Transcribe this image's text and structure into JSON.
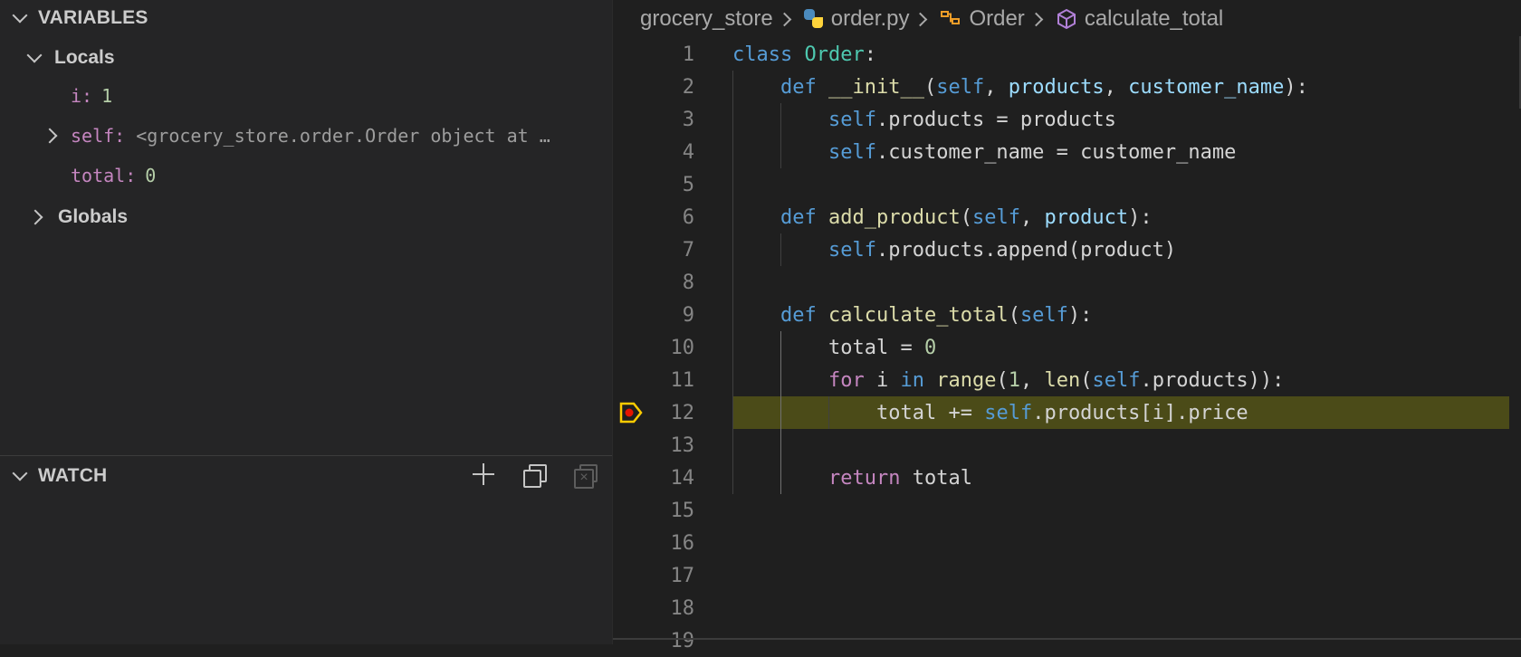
{
  "sidebar": {
    "variables_title": "VARIABLES",
    "locals_label": "Locals",
    "locals": [
      {
        "name": "i:",
        "value": "1",
        "kind": "number"
      },
      {
        "name": "self:",
        "value": "<grocery_store.order.Order object at …",
        "kind": "object"
      },
      {
        "name": "total:",
        "value": "0",
        "kind": "number"
      }
    ],
    "globals_label": "Globals",
    "watch_title": "WATCH"
  },
  "breadcrumb": {
    "folder": "grocery_store",
    "file": "order.py",
    "class": "Order",
    "method": "calculate_total"
  },
  "editor": {
    "highlight_line": 12,
    "lines": [
      {
        "n": "1",
        "indent": 0,
        "tokens": [
          [
            "k",
            "class"
          ],
          [
            "",
            " "
          ],
          [
            "cls",
            "Order"
          ],
          [
            "",
            ":"
          ]
        ]
      },
      {
        "n": "2",
        "indent": 1,
        "tokens": [
          [
            "k",
            "def"
          ],
          [
            "",
            " "
          ],
          [
            "fn",
            "__init__"
          ],
          [
            "",
            "("
          ],
          [
            "sl",
            "self"
          ],
          [
            "",
            ", "
          ],
          [
            "pm",
            "products"
          ],
          [
            "",
            ", "
          ],
          [
            "pm",
            "customer_name"
          ],
          [
            "",
            "):"
          ]
        ]
      },
      {
        "n": "3",
        "indent": 2,
        "tokens": [
          [
            "sl",
            "self"
          ],
          [
            "",
            ".products = products"
          ]
        ]
      },
      {
        "n": "4",
        "indent": 2,
        "tokens": [
          [
            "sl",
            "self"
          ],
          [
            "",
            ".customer_name = customer_name"
          ]
        ]
      },
      {
        "n": "5",
        "indent": 0,
        "tokens": []
      },
      {
        "n": "6",
        "indent": 1,
        "tokens": [
          [
            "k",
            "def"
          ],
          [
            "",
            " "
          ],
          [
            "fn",
            "add_product"
          ],
          [
            "",
            "("
          ],
          [
            "sl",
            "self"
          ],
          [
            "",
            ", "
          ],
          [
            "pm",
            "product"
          ],
          [
            "",
            "):"
          ]
        ]
      },
      {
        "n": "7",
        "indent": 2,
        "tokens": [
          [
            "sl",
            "self"
          ],
          [
            "",
            ".products.append(product)"
          ]
        ]
      },
      {
        "n": "8",
        "indent": 0,
        "tokens": []
      },
      {
        "n": "9",
        "indent": 1,
        "tokens": [
          [
            "k",
            "def"
          ],
          [
            "",
            " "
          ],
          [
            "fn",
            "calculate_total"
          ],
          [
            "",
            "("
          ],
          [
            "sl",
            "self"
          ],
          [
            "",
            "):"
          ]
        ]
      },
      {
        "n": "10",
        "indent": 2,
        "tokens": [
          [
            "",
            "total = "
          ],
          [
            "nm",
            "0"
          ]
        ]
      },
      {
        "n": "11",
        "indent": 2,
        "tokens": [
          [
            "kc",
            "for"
          ],
          [
            "",
            " i "
          ],
          [
            "k",
            "in"
          ],
          [
            "",
            " "
          ],
          [
            "fn",
            "range"
          ],
          [
            "",
            "("
          ],
          [
            "nm",
            "1"
          ],
          [
            "",
            ", "
          ],
          [
            "fn",
            "len"
          ],
          [
            "",
            "("
          ],
          [
            "sl",
            "self"
          ],
          [
            "",
            ".products)):"
          ]
        ]
      },
      {
        "n": "12",
        "indent": 3,
        "tokens": [
          [
            "",
            "total += "
          ],
          [
            "sl",
            "self"
          ],
          [
            "",
            ".products[i].price"
          ]
        ]
      },
      {
        "n": "13",
        "indent": 0,
        "tokens": []
      },
      {
        "n": "14",
        "indent": 2,
        "tokens": [
          [
            "kc",
            "return"
          ],
          [
            "",
            " total"
          ]
        ]
      },
      {
        "n": "15",
        "indent": 0,
        "tokens": []
      },
      {
        "n": "16",
        "indent": 0,
        "tokens": []
      },
      {
        "n": "17",
        "indent": 0,
        "tokens": []
      },
      {
        "n": "18",
        "indent": 0,
        "tokens": []
      },
      {
        "n": "19",
        "indent": 0,
        "tokens": []
      }
    ]
  },
  "colors": {
    "breakpoint": "#e51400",
    "current_frame": "#ffcc00",
    "highlight": "#4b4b18"
  }
}
